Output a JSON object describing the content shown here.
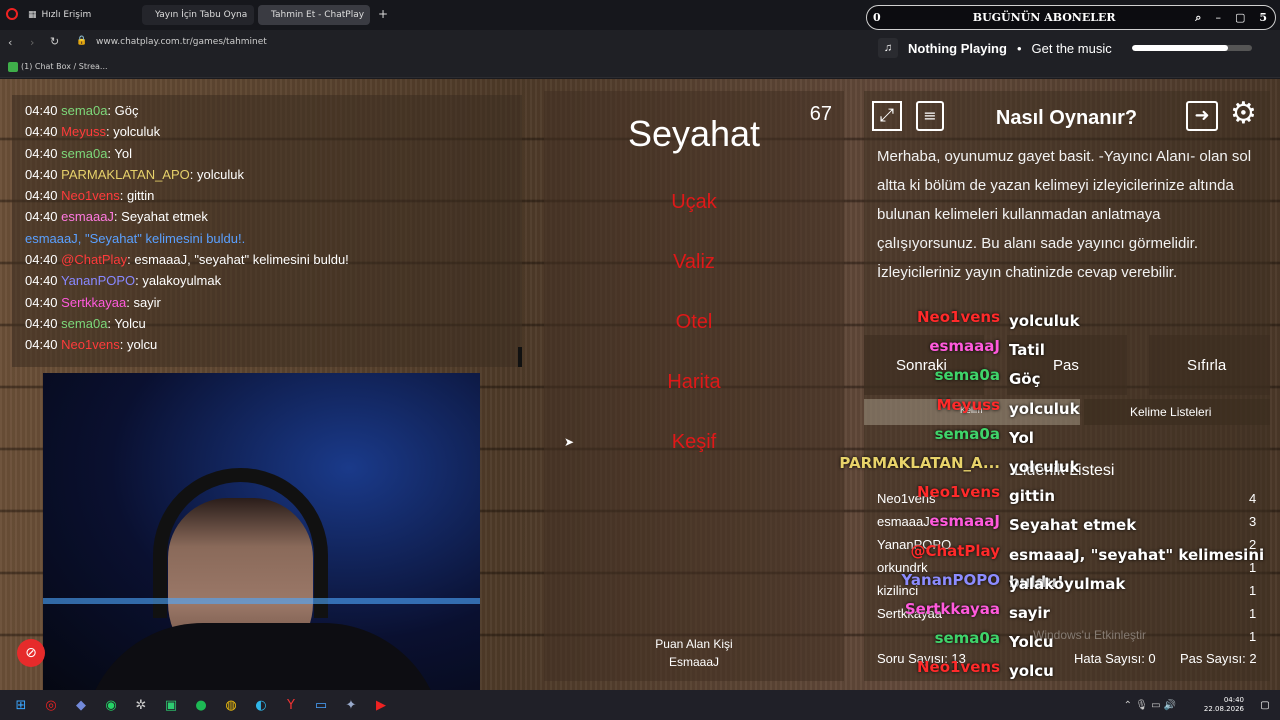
{
  "browser": {
    "tabs": [
      {
        "label": "Hızlı Erişim"
      },
      {
        "label": "Yayın İçin Tabu Oyna"
      },
      {
        "label": "Tahmin Et - ChatPlay"
      }
    ],
    "url": "www.chatplay.com.tr/games/tahminet",
    "bookmark": "(1) Chat Box / Strea..."
  },
  "subs_overlay": {
    "count": "0",
    "title": "BUGÜNÜN ABONELER",
    "right_count": "5"
  },
  "music": {
    "status": "Nothing Playing",
    "cta": "Get the music",
    "progress": 0.8
  },
  "chat": {
    "messages": [
      {
        "time": "04:40",
        "user": "sema0a",
        "text": ": Göç",
        "color": "#7dd87a"
      },
      {
        "time": "04:40",
        "user": "Meyuss",
        "text": ": yolculuk",
        "color": "#ff3b3b"
      },
      {
        "time": "04:40",
        "user": "sema0a",
        "text": ": Yol",
        "color": "#7dd87a"
      },
      {
        "time": "04:40",
        "user": "PARMAKLATAN_APO",
        "text": ": yolculuk",
        "color": "#e6d16a"
      },
      {
        "time": "04:40",
        "user": "Neo1vens",
        "text": ": gittin",
        "color": "#ff3b3b"
      },
      {
        "time": "04:40",
        "user": "esmaaaJ",
        "text": ": Seyahat etmek",
        "color": "#ff79e0"
      },
      {
        "time": "",
        "user": "",
        "text": "esmaaaJ, \"Seyahat\" kelimesini buldu!.",
        "color": "#5aa0ff"
      },
      {
        "time": "04:40",
        "user": "@ChatPlay",
        "text": ": esmaaaJ, \"seyahat\" kelimesini buldu!",
        "color": "#ff3b3b"
      },
      {
        "time": "04:40",
        "user": "YananPOPO",
        "text": ": yalakoyulmak",
        "color": "#8888ff"
      },
      {
        "time": "04:40",
        "user": "Sertkkayaa",
        "text": ": sayir",
        "color": "#ff5adc"
      },
      {
        "time": "04:40",
        "user": "sema0a",
        "text": ": Yolcu",
        "color": "#7dd87a"
      },
      {
        "time": "04:40",
        "user": "Neo1vens",
        "text": ": yolcu",
        "color": "#ff3b3b"
      }
    ]
  },
  "game": {
    "timer": "67",
    "word": "Seyahat",
    "forbidden": [
      "Uçak",
      "Valiz",
      "Otel",
      "Harita",
      "Keşif"
    ],
    "scorer_label": "Puan Alan Kişi",
    "scorer": "EsmaaaJ"
  },
  "help": {
    "title": "Nasıl Oynanır?",
    "text": "Merhaba, oyunumuz gayet basit. -Yayıncı Alanı- olan sol altta ki bölüm de yazan kelimeyi izleyicilerinize altında bulunan kelimeleri kullanmadan anlatmaya çalışıyorsunuz. Bu alanı sade yayıncı görmelidir. İzleyicileriniz yayın chatinizde cevap verebilir."
  },
  "controls": {
    "next": "Sonraki",
    "pass": "Pas",
    "reset": "Sıfırla",
    "word_btn": "Kelim",
    "word_lists": "Kelime Listeleri"
  },
  "leaderboard": {
    "title": "Liderlik Listesi",
    "rows": [
      {
        "name": "Neo1vens",
        "score": "4"
      },
      {
        "name": "esmaaaJ",
        "score": "3"
      },
      {
        "name": "YananPOPO",
        "score": "2"
      },
      {
        "name": "orkundrk",
        "score": "1"
      },
      {
        "name": "kizilinci",
        "score": "1"
      },
      {
        "name": "Sertkkayaa",
        "score": "1"
      },
      {
        "name": "",
        "score": "1"
      }
    ],
    "question_count": "Soru Sayısı: 13",
    "error_count": "Hata Sayısı: 0",
    "pass_count": "Pas Sayısı: 2"
  },
  "overlay_chat": [
    {
      "user": "Neo1vens",
      "text": "yolculuk",
      "color": "#ff2a2a"
    },
    {
      "user": "esmaaaJ",
      "text": "Tatil",
      "color": "#ff5adc"
    },
    {
      "user": "sema0a",
      "text": "Göç",
      "color": "#3fd46a"
    },
    {
      "user": "Meyuss",
      "text": "yolculuk",
      "color": "#ff2a2a"
    },
    {
      "user": "sema0a",
      "text": "Yol",
      "color": "#3fd46a"
    },
    {
      "user": "PARMAKLATAN_A...",
      "text": "yolculuk",
      "color": "#e8d36a"
    },
    {
      "user": "Neo1vens",
      "text": "gittin",
      "color": "#ff2a2a"
    },
    {
      "user": "esmaaaJ",
      "text": "Seyahat etmek",
      "color": "#ff5adc"
    },
    {
      "user": "@ChatPlay",
      "text": "esmaaaJ, \"seyahat\" kelimesini buldu!",
      "color": "#ff2a2a"
    },
    {
      "user": "YananPOPO",
      "text": "yalakoyulmak",
      "color": "#8c8cff"
    },
    {
      "user": "Sertkkayaa",
      "text": "sayir",
      "color": "#ff5adc"
    },
    {
      "user": "sema0a",
      "text": "Yolcu",
      "color": "#3fd46a"
    },
    {
      "user": "Neo1vens",
      "text": "yolcu",
      "color": "#ff2a2a"
    }
  ],
  "watermark": "Windows'u Etkinleştir",
  "taskbar": {
    "time": "04:40",
    "date": "22.08.2026"
  }
}
